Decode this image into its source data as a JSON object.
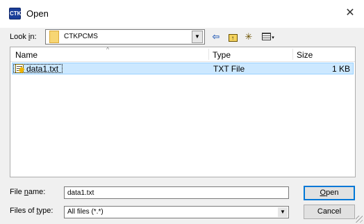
{
  "window": {
    "title": "Open",
    "icon": "ctk-app-icon",
    "close_glyph": "✕"
  },
  "lookin": {
    "label_pre": "Look ",
    "label_u": "i",
    "label_post": "n:",
    "value": "CTKPCMS"
  },
  "toolbar": {
    "back": "⇦",
    "newfolder": "✳",
    "caret": "▾"
  },
  "list": {
    "columns": [
      "Name",
      "Type",
      "Size"
    ],
    "rows": [
      {
        "name": "data1.txt",
        "type": "TXT File",
        "size": "1 KB"
      }
    ]
  },
  "filename": {
    "label_pre": "File ",
    "label_u": "n",
    "label_post": "ame:",
    "value": "data1.txt"
  },
  "filetype": {
    "label_pre": "Files of ",
    "label_u": "t",
    "label_post": "ype:",
    "value": "All files (*.*)"
  },
  "buttons": {
    "open_u": "O",
    "open_rest": "pen",
    "cancel": "Cancel"
  }
}
